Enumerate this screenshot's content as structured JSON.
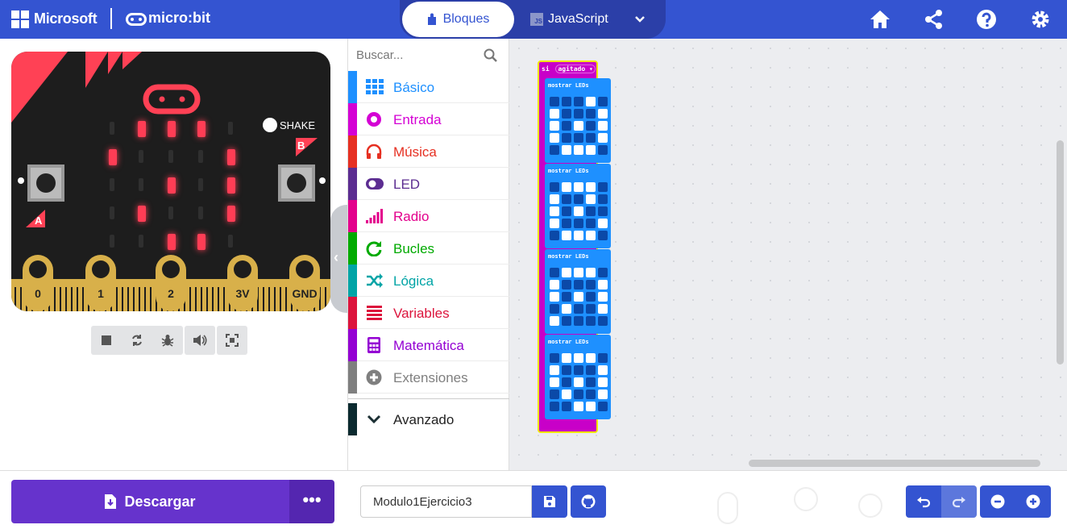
{
  "header": {
    "brand": "Microsoft",
    "product": "micro:bit",
    "tab_blocks": "Bloques",
    "tab_js": "JavaScript",
    "js_badge": "JS",
    "icons": [
      "home-icon",
      "share-icon",
      "help-icon",
      "gear-icon"
    ]
  },
  "simulator": {
    "shake_label": "SHAKE",
    "button_a": "A",
    "button_b": "B",
    "pins": [
      "0",
      "1",
      "2",
      "3V",
      "GND"
    ],
    "led_matrix": [
      [
        0,
        1,
        1,
        1,
        0
      ],
      [
        1,
        0,
        0,
        0,
        1
      ],
      [
        0,
        0,
        1,
        0,
        1
      ],
      [
        0,
        1,
        0,
        0,
        1
      ],
      [
        0,
        0,
        1,
        1,
        0
      ]
    ],
    "toolbar_icons": [
      "stop-icon",
      "restart-icon",
      "debug-icon",
      "sound-icon",
      "fullscreen-icon"
    ]
  },
  "toolbox": {
    "search_placeholder": "Buscar...",
    "categories": [
      {
        "label": "Básico",
        "color": "#1e90ff"
      },
      {
        "label": "Entrada",
        "color": "#d400d4"
      },
      {
        "label": "Música",
        "color": "#e63022"
      },
      {
        "label": "LED",
        "color": "#5c2d91"
      },
      {
        "label": "Radio",
        "color": "#e3008c"
      },
      {
        "label": "Bucles",
        "color": "#00aa00"
      },
      {
        "label": "Lógica",
        "color": "#00a4a6"
      },
      {
        "label": "Variables",
        "color": "#dc143c"
      },
      {
        "label": "Matemática",
        "color": "#9400d3"
      },
      {
        "label": "Extensiones",
        "color": "#7f7f7f"
      }
    ],
    "advanced": "Avanzado"
  },
  "workspace": {
    "event_label": "si",
    "event_dropdown": "agitado ▾",
    "show_leds_label": "mostrar LEDs",
    "blocks": [
      [
        [
          0,
          0,
          0,
          1,
          0
        ],
        [
          1,
          0,
          0,
          0,
          1
        ],
        [
          1,
          0,
          1,
          0,
          1
        ],
        [
          1,
          0,
          0,
          0,
          1
        ],
        [
          0,
          1,
          1,
          1,
          0
        ]
      ],
      [
        [
          0,
          1,
          1,
          1,
          0
        ],
        [
          1,
          0,
          0,
          1,
          0
        ],
        [
          1,
          0,
          1,
          0,
          0
        ],
        [
          1,
          0,
          0,
          0,
          1
        ],
        [
          0,
          1,
          1,
          1,
          0
        ]
      ],
      [
        [
          0,
          1,
          1,
          1,
          0
        ],
        [
          1,
          0,
          0,
          0,
          1
        ],
        [
          1,
          0,
          1,
          0,
          1
        ],
        [
          0,
          1,
          0,
          0,
          1
        ],
        [
          1,
          0,
          0,
          0,
          0
        ]
      ],
      [
        [
          0,
          1,
          1,
          1,
          0
        ],
        [
          1,
          0,
          0,
          0,
          1
        ],
        [
          1,
          0,
          1,
          0,
          1
        ],
        [
          0,
          1,
          0,
          0,
          1
        ],
        [
          0,
          0,
          1,
          1,
          0
        ]
      ]
    ]
  },
  "footer": {
    "download": "Descargar",
    "more": "•••",
    "project_name": "Modulo1Ejercicio3"
  },
  "colors": {
    "header": "#3454d1",
    "download": "#6633cc",
    "event_block": "#c800c8",
    "show_leds_block": "#1e90ff",
    "led_on": "#ff3d55"
  }
}
